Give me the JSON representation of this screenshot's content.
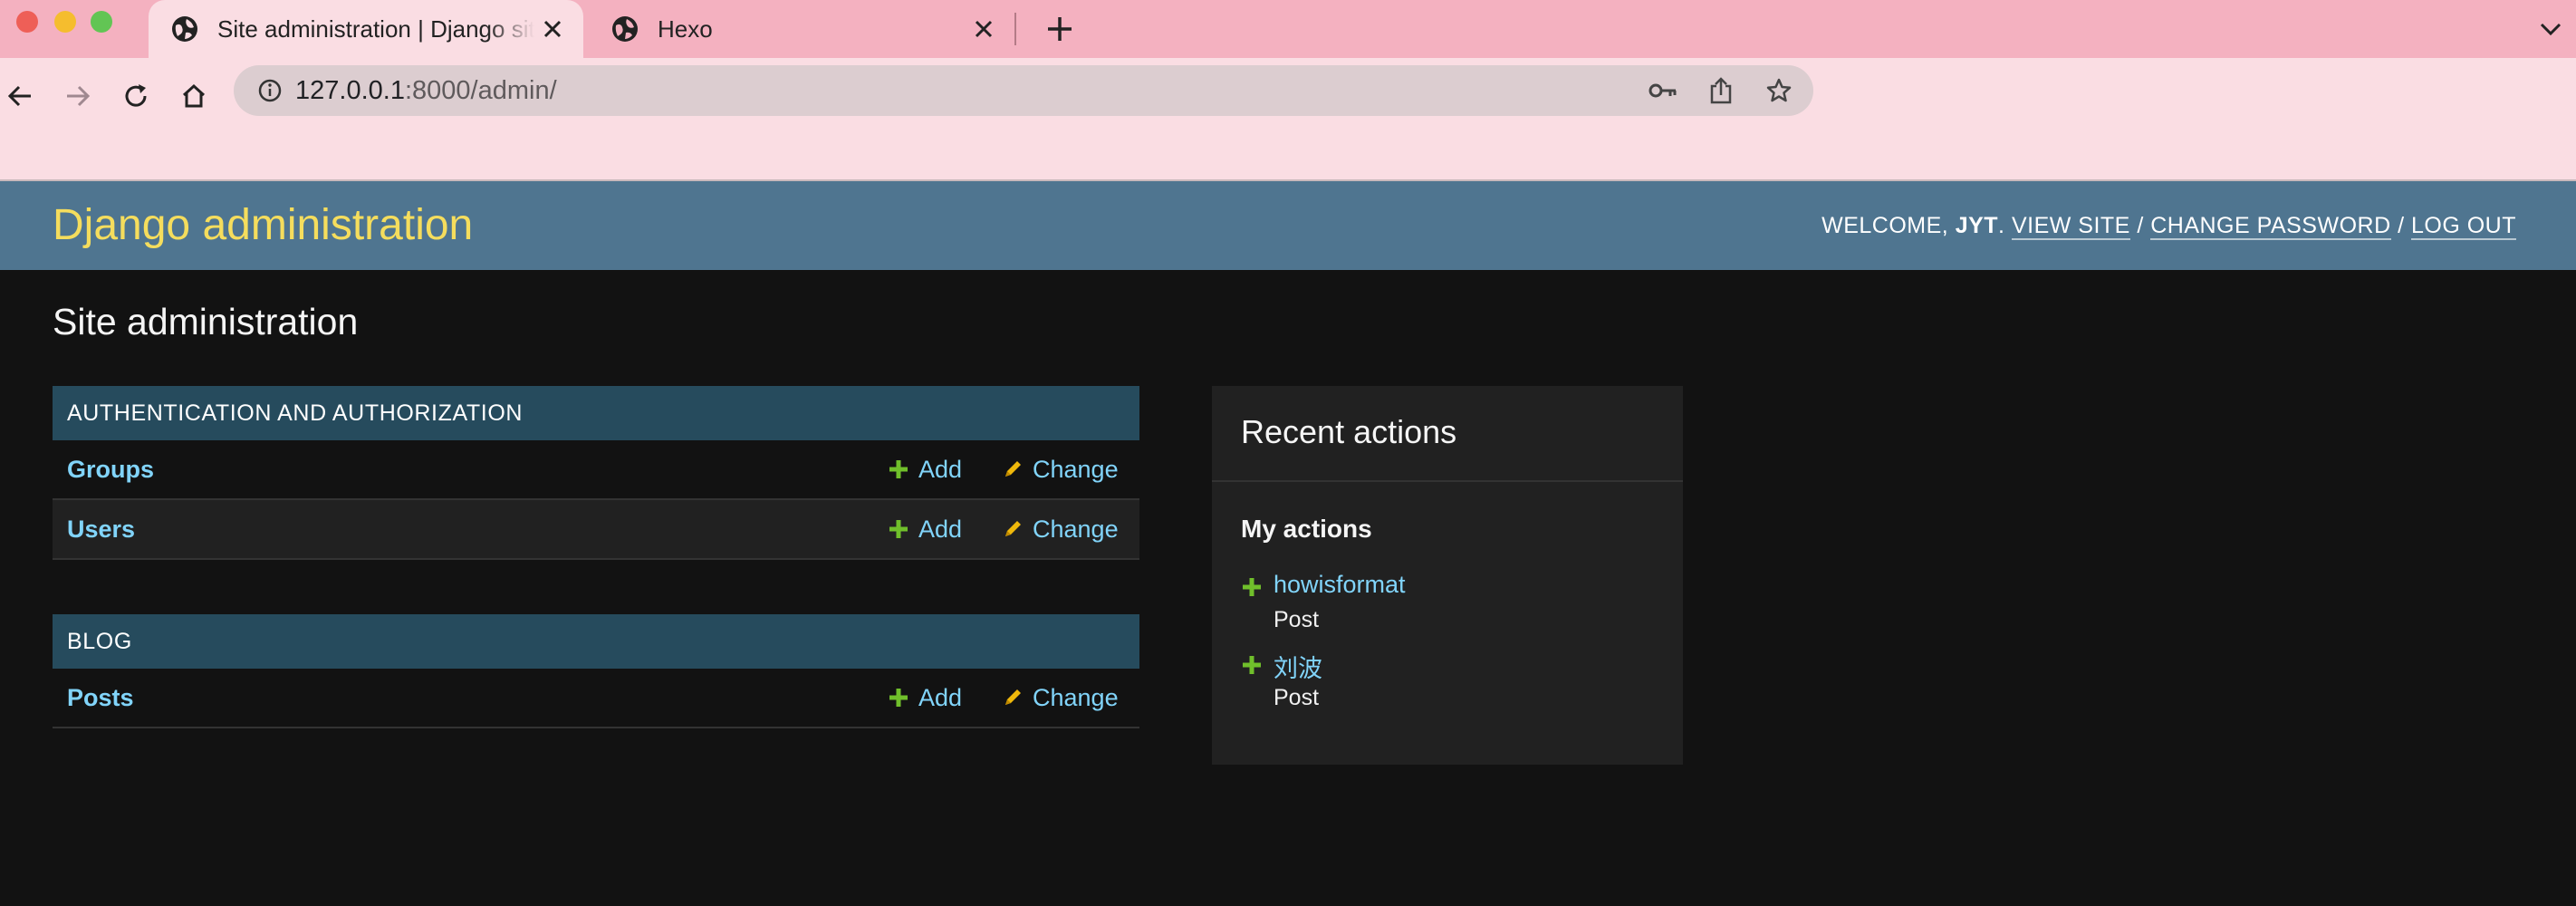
{
  "browser": {
    "tabs": [
      {
        "title": "Site administration | Django site admin",
        "active": true
      },
      {
        "title": "Hexo",
        "active": false
      }
    ],
    "url_host": "127.0.0.1",
    "url_rest": ":8000/admin/"
  },
  "header": {
    "branding": "Django administration",
    "welcome": "Welcome,",
    "username": "JYT",
    "view_site": "View site",
    "change_password": "Change password",
    "log_out": "Log out",
    "separator": "/"
  },
  "content": {
    "title": "Site administration",
    "apps": [
      {
        "caption": "Authentication and Authorization",
        "models": [
          {
            "name": "Groups",
            "add": "Add",
            "change": "Change"
          },
          {
            "name": "Users",
            "add": "Add",
            "change": "Change"
          }
        ]
      },
      {
        "caption": "Blog",
        "models": [
          {
            "name": "Posts",
            "add": "Add",
            "change": "Change"
          }
        ]
      }
    ]
  },
  "recent_actions": {
    "title": "Recent actions",
    "subtitle": "My actions",
    "entries": [
      {
        "object": "howisformat",
        "type": "Post",
        "action": "add"
      },
      {
        "object": "刘波",
        "type": "Post",
        "action": "add"
      }
    ]
  },
  "colors": {
    "header_bg": "#4f7590",
    "branding": "#f5dd5d",
    "link": "#81d4fa",
    "add_icon": "#70bf2b",
    "change_icon": "#efb80b",
    "module_caption_bg": "#264b5d",
    "page_bg": "#121212"
  }
}
